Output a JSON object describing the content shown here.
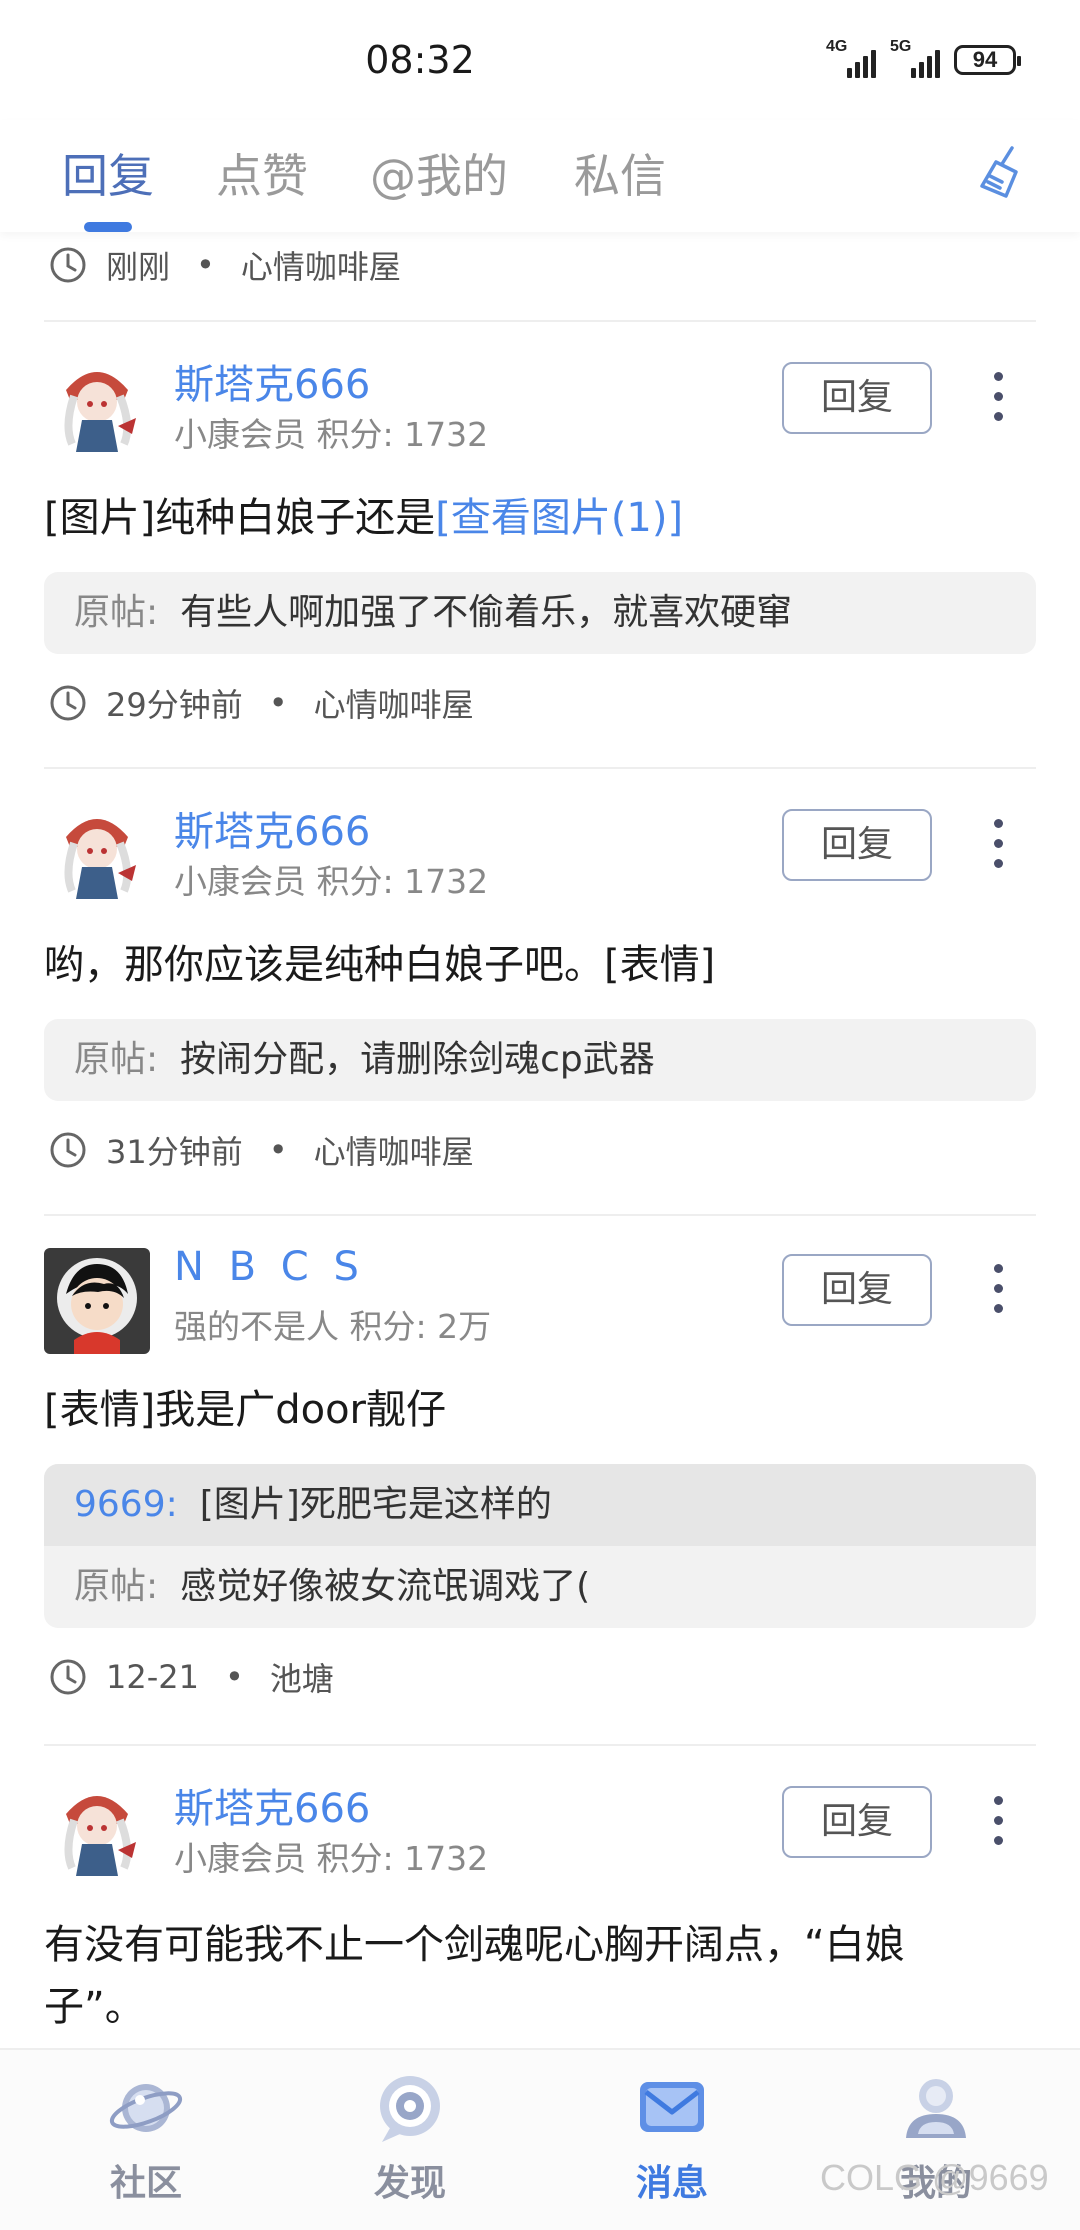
{
  "status": {
    "time": "08:32",
    "net1": "4G",
    "net2": "5G",
    "battery": "94"
  },
  "tabs": [
    {
      "label": "回复",
      "active": true
    },
    {
      "label": "点赞"
    },
    {
      "label": "@我的"
    },
    {
      "label": "私信"
    }
  ],
  "top_meta": {
    "time": "刚刚",
    "forum": "心情咖啡屋"
  },
  "posts": [
    {
      "user": "斯塔克666",
      "title": "小康会员",
      "points": "积分: 1732",
      "content": "[图片]纯种白娘子还是",
      "content_link": "[查看图片(1)]",
      "quote": {
        "label": "原帖:",
        "text": "有些人啊加强了不偷着乐，就喜欢硬窜"
      },
      "meta": {
        "time": "29分钟前",
        "forum": "心情咖啡屋"
      }
    },
    {
      "user": "斯塔克666",
      "title": "小康会员",
      "points": "积分: 1732",
      "content": "哟，那你应该是纯种白娘子吧。[表情]",
      "quote": {
        "label": "原帖:",
        "text": "按闹分配，请删除剑魂cp武器"
      },
      "meta": {
        "time": "31分钟前",
        "forum": "心情咖啡屋"
      }
    },
    {
      "user": "N B C S",
      "title": "强的不是人",
      "points": "积分: 2万",
      "content": "[表情]我是广door靓仔",
      "quote_hl": {
        "label": "9669:",
        "text": "[图片]死肥宅是这样的"
      },
      "quote": {
        "label": "原帖:",
        "text": "感觉好像被女流氓调戏了("
      },
      "meta": {
        "time": "12-21",
        "forum": "池塘"
      }
    },
    {
      "user": "斯塔克666",
      "title": "小康会员",
      "points": "积分: 1732",
      "content": "有没有可能我不止一个剑魂呢心胸开阔点，“白娘子”。"
    }
  ],
  "reply_label": "回复",
  "nav": [
    {
      "label": "社区"
    },
    {
      "label": "发现"
    },
    {
      "label": "消息",
      "active": true
    },
    {
      "label": "我的"
    }
  ],
  "watermark": "COLG @9669",
  "colors": {
    "accent": "#3f7ae0",
    "username": "#4a86e8",
    "tab_active": "#4d6fb8"
  }
}
